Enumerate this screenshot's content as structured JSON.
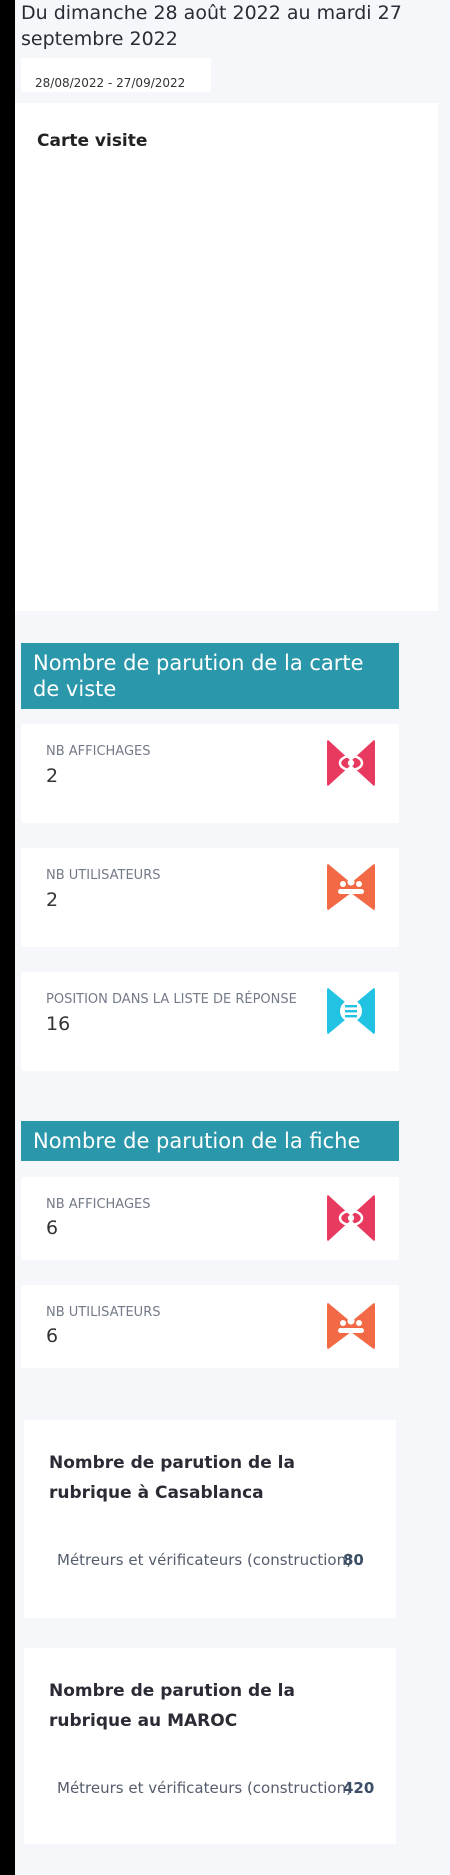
{
  "period": {
    "text": "Du dimanche 28 août 2022 au mardi 27 septembre 2022",
    "range_value": "28/08/2022 - 27/09/2022"
  },
  "map_card": {
    "title": "Carte visite"
  },
  "section_carte": {
    "title": "Nombre de parution de la carte de viste",
    "stats": [
      {
        "label": "NB AFFICHAGES",
        "value": "2",
        "icon": "eye-icon",
        "color": "#e8395f"
      },
      {
        "label": "NB UTILISATEURS",
        "value": "2",
        "icon": "users-icon",
        "color": "#f16a45"
      },
      {
        "label": "POSITION DANS LA LISTE DE RÉPONSE",
        "value": "16",
        "icon": "list-icon",
        "color": "#22c2e3"
      }
    ]
  },
  "section_fiche": {
    "title": "Nombre de parution de la fiche",
    "stats": [
      {
        "label": "NB AFFICHAGES",
        "value": "6",
        "icon": "eye-icon",
        "color": "#e8395f"
      },
      {
        "label": "NB UTILISATEURS",
        "value": "6",
        "icon": "users-icon",
        "color": "#f16a45"
      }
    ]
  },
  "rubrique_casablanca": {
    "title": "Nombre de parution de la rubrique à Casablanca",
    "row_label": "Métreurs et vérificateurs (construction)",
    "row_count": "80"
  },
  "rubrique_maroc": {
    "title": "Nombre de parution de la rubrique au MAROC",
    "row_label": "Métreurs et vérificateurs (construction)",
    "row_count": "420"
  }
}
